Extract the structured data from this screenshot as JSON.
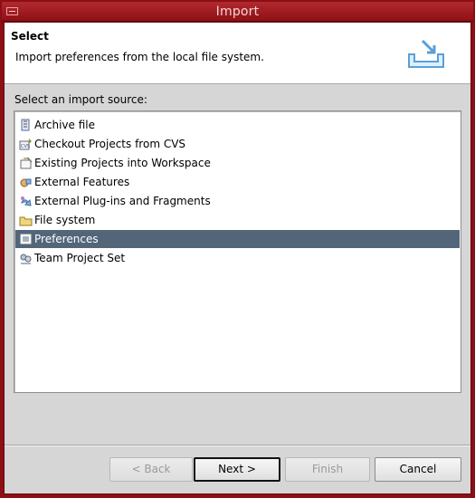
{
  "window": {
    "title": "Import"
  },
  "banner": {
    "title": "Select",
    "description": "Import preferences from the local file system.",
    "icon": "import-wizard-icon"
  },
  "source": {
    "label": "Select an import source:"
  },
  "list": {
    "items": [
      {
        "label": "Archive file",
        "icon": "archive-icon",
        "selected": false
      },
      {
        "label": "Checkout Projects from CVS",
        "icon": "cvs-icon",
        "selected": false
      },
      {
        "label": "Existing Projects into Workspace",
        "icon": "project-icon",
        "selected": false
      },
      {
        "label": "External Features",
        "icon": "feature-icon",
        "selected": false
      },
      {
        "label": "External Plug-ins and Fragments",
        "icon": "plugin-icon",
        "selected": false
      },
      {
        "label": "File system",
        "icon": "folder-icon",
        "selected": false
      },
      {
        "label": "Preferences",
        "icon": "preferences-icon",
        "selected": true
      },
      {
        "label": "Team Project Set",
        "icon": "team-icon",
        "selected": false
      }
    ]
  },
  "buttons": {
    "back": "< Back",
    "next": "Next >",
    "finish": "Finish",
    "cancel": "Cancel"
  },
  "colors": {
    "window_frame": "#8b0f14",
    "selection": "#536579",
    "background": "#d6d6d6"
  }
}
